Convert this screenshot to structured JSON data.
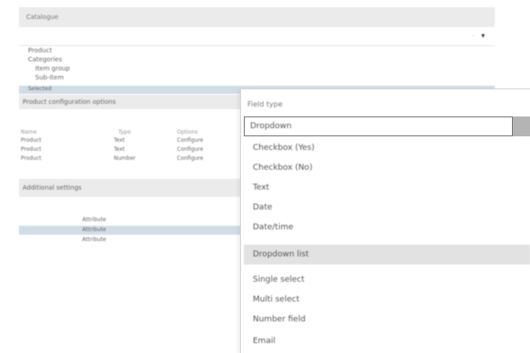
{
  "panel": {
    "title": "Catalogue",
    "filter_value": "",
    "tree": [
      "Product",
      "Categories",
      "Item group",
      "Sub-item"
    ],
    "selected_tree": "Selected",
    "section_header": "Product configuration options",
    "table": {
      "headers": [
        "Name",
        "Type",
        "Options"
      ],
      "rows": [
        [
          "Product",
          "Text",
          "Configure"
        ],
        [
          "Product",
          "Text",
          "Configure"
        ],
        [
          "Product",
          "Number",
          "Configure"
        ]
      ]
    },
    "bottom_header": "Additional settings",
    "bottom_items": [
      "Attribute",
      "Attribute",
      "Attribute"
    ]
  },
  "dropdown": {
    "header_label": "Field type",
    "input_value": "Dropdown",
    "options": [
      "Checkbox (Yes)",
      "Checkbox (No)",
      "Text",
      "Date",
      "Date/time",
      "Dropdown list",
      "Single select",
      "Multi select",
      "Number field",
      "Email"
    ],
    "highlighted_index": 5
  },
  "colors": {
    "header_bg": "#ebebeb",
    "selected_row_bg": "#d2dce6",
    "highlight_bg": "#e2e2e2",
    "scrollbar": "#b4b4b4"
  }
}
